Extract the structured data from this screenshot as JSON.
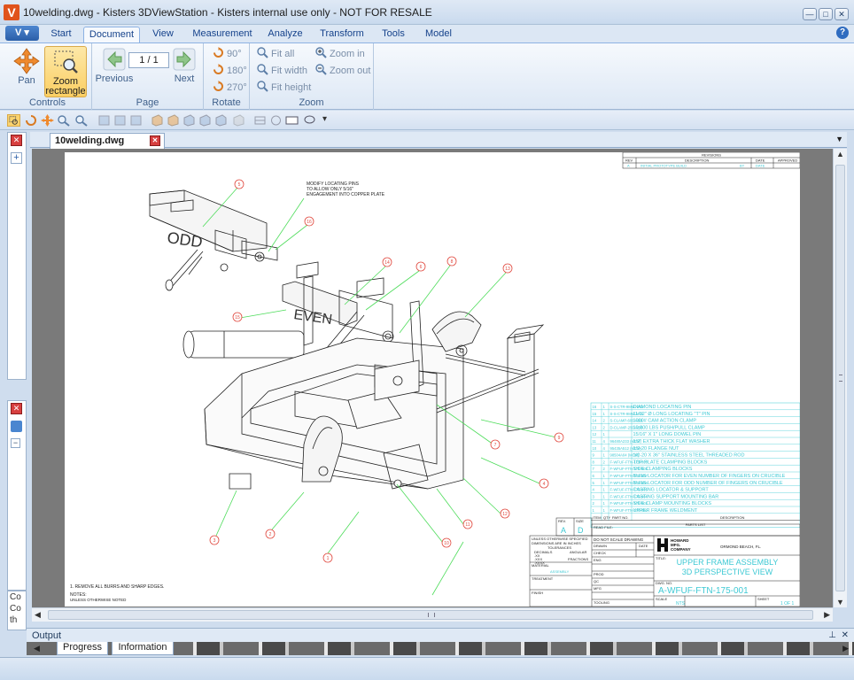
{
  "window": {
    "title": "10welding.dwg - Kisters 3DViewStation - Kisters internal use only - NOT FOR RESALE",
    "app_logo_letter": "V",
    "minimize": "—",
    "maximize": "□",
    "close": "✕"
  },
  "ribbon_tabs": [
    {
      "label": "Start"
    },
    {
      "label": "Document",
      "active": true
    },
    {
      "label": "View"
    },
    {
      "label": "Measurement"
    },
    {
      "label": "Analyze"
    },
    {
      "label": "Transform"
    },
    {
      "label": "Tools"
    },
    {
      "label": "Model"
    }
  ],
  "ribbon": {
    "controls": {
      "pan": "Pan",
      "zoom_rect_1": "Zoom",
      "zoom_rect_2": "rectangle",
      "label": "Controls"
    },
    "page": {
      "previous": "Previous",
      "next": "Next",
      "value": "1 / 1",
      "label": "Page"
    },
    "rotate": {
      "r90": "90°",
      "r180": "180°",
      "r270": "270°",
      "label": "Rotate"
    },
    "zoom": {
      "fit_all": "Fit all",
      "fit_width": "Fit width",
      "fit_height": "Fit height",
      "zoom_in": "Zoom in",
      "zoom_out": "Zoom out",
      "label": "Zoom"
    }
  },
  "document_tab": {
    "label": "10welding.dwg"
  },
  "drawing": {
    "note_top": [
      "MODIFY LOCATING PINS",
      "TO ALLOW ONLY 5/16\"",
      "ENGAGEMENT INTO COPPER PLATE"
    ],
    "odd_label": "ODD",
    "even_label": "EVEN",
    "balloons": [
      "5",
      "16",
      "14",
      "6",
      "8",
      "13",
      "15",
      "7",
      "9",
      "4",
      "12",
      "11",
      "10",
      "2",
      "3",
      "1"
    ],
    "notes": [
      "1. REMOVE ALL BURRS AND SHARP EDGES.",
      "NOTES:",
      "UNLESS OTHERWISE NOTED"
    ],
    "revisions": {
      "title": "REVISIONS",
      "headers": [
        "REV",
        "DESCRIPTION",
        "DATE",
        "APPROVED"
      ],
      "row": [
        "A",
        "INITIAL PROTOTYPE BUILD",
        "BY",
        "DATE",
        ""
      ]
    },
    "parts_list": {
      "rows": [
        [
          "16",
          "1",
          "S-S-CTR-9MM.ANS",
          "DIAMOND LOCATING PIN"
        ],
        [
          "15",
          "1",
          "S-S-CTR-9MM.ANS",
          "11/32\" Ø  LONG LOCATING \"T\" PIN"
        ],
        [
          "14",
          "2",
          "S-CLAMP-600-ABB",
          "1000# CAM ACTION CLAMP"
        ],
        [
          "13",
          "2",
          "D-CLAMP-250-ABB",
          "10,000 LBS PUSH/PULL CLAMP"
        ],
        [
          "12",
          "1",
          "",
          "15/16\" X 1\" LONG DOWEL PIN"
        ],
        [
          "11",
          "4",
          "96480A233 (MCM)",
          "1/2\" EXTRA THICK FLAT WASHER"
        ],
        [
          "10",
          "4",
          "95435A512 (MCM)",
          "1/2-20 FLANGE NUT"
        ],
        [
          "9",
          "1",
          "98504A04 (MCM)",
          "1/2-20 X 36\" STAINLESS STEEL THREADED ROD"
        ],
        [
          "8",
          "2",
          "F-WFUF-FTN-175-009",
          "TOP PLATE CLAMPING BLOCKS"
        ],
        [
          "7",
          "2",
          "F-WFUF-FTN-175-008",
          "SIDE CLAMPING BLOCKS"
        ],
        [
          "6",
          "1",
          "F-WFUF-FTN-175-007",
          "BUSS LOCATOR FOR EVEN NUMBER OF FINGERS ON CRUCIBLE"
        ],
        [
          "5",
          "1",
          "F-WFUF-FTN-175-006",
          "BUSS LOCATOR FOR ODD NUMBER OF FINGERS ON CRUCIBLE"
        ],
        [
          "4",
          "1",
          "F-WFUF-FTN-175-005",
          "CASTING LOCATOR & SUPPORT"
        ],
        [
          "3",
          "1",
          "F-WFUF-FTN-175-004",
          "CASTING SUPPORT MOUNTING BAR"
        ],
        [
          "2",
          "1",
          "F-WFUF-FTN-175-003",
          "SIDE CLAMP MOUNTING BLOCKS"
        ],
        [
          "1",
          "1",
          "F-WFUF-FTN-175-002",
          "UPPER FRAME WELDMENT"
        ]
      ],
      "footer_headers": [
        "ITEM",
        "QTY",
        "PART NO.",
        "DESCRIPTION"
      ],
      "title": "PARTS LIST"
    },
    "title_block": {
      "tolerances": [
        "UNLESS OTHERWISE SPECIFIED",
        "DIMENSIONS ARE IN INCHES",
        "TOLERANCES",
        "DECIMALS",
        "ANGULAR",
        ".XX",
        ".XXX",
        ".XXXX",
        "FRACTIONS"
      ],
      "do_not_scale": "DO NOT SCALE DRAWING",
      "drawn": "DRAWN",
      "check": "CHECK",
      "eng": "ENG",
      "prod": "PROD",
      "qc": "QC",
      "mfg": "MFG",
      "tooling": "TOOLING",
      "date": "DATE",
      "material": "MATERIAL",
      "material_value": "ASSEMBLY",
      "treatment": "TREATMENT",
      "finish": "FINISH",
      "rev": "REV.",
      "rev_value": "A",
      "size": "SIZE",
      "size_value": "D",
      "read_file": "READ FILE:",
      "company": [
        "HOWARD",
        "MFG.",
        "COMPANY"
      ],
      "city": "ORMOND BEACH, FL.",
      "title_label": "TITLE:",
      "title_lines": [
        "UPPER FRAME ASSEMBLY",
        "3D PERSPECTIVE VIEW"
      ],
      "dwg_no_label": "DWG. NO.",
      "dwg_no": "A-WFUF-FTN-175-001",
      "scale_label": "SCALE",
      "scale_value": "NTS",
      "sheet_label": "SHEET",
      "sheet_value": "1 OF 1"
    }
  },
  "output_panel": {
    "title": "Output"
  },
  "bottom_tabs": [
    {
      "label": "Progress"
    },
    {
      "label": "Information"
    }
  ],
  "left_panel_text": [
    "Co",
    "Co",
    "th"
  ],
  "colors": {
    "accent": "#fbcf63",
    "drawing_text": "#3ec9d4",
    "leader_green": "#4ddc5a",
    "balloon_red": "#e0473d"
  }
}
